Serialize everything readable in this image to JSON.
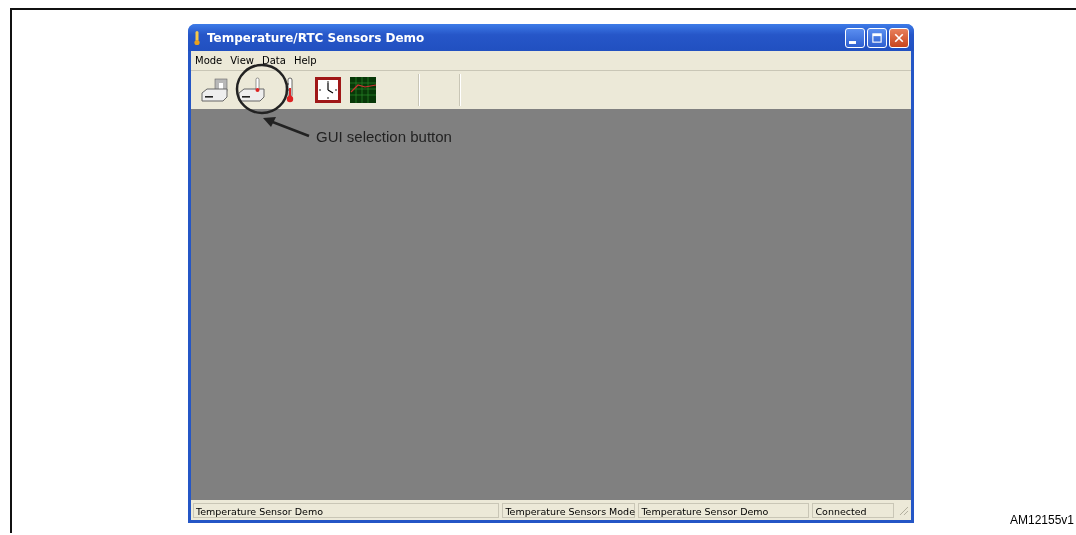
{
  "window": {
    "title": "Temperature/RTC Sensors Demo"
  },
  "menu": [
    "Mode",
    "View",
    "Data",
    "Help"
  ],
  "toolbar": [
    {
      "kind": "board"
    },
    {
      "kind": "board-thermo"
    },
    {
      "kind": "thermometer"
    },
    {
      "kind": "clock"
    },
    {
      "kind": "chart"
    }
  ],
  "annotation": {
    "text": "GUI selection button"
  },
  "status_bar": [
    "Temperature Sensor Demo",
    "Temperature Sensors Mode",
    "Temperature Sensor Demo",
    "Connected"
  ],
  "figure": {
    "label": "AM12155v1"
  }
}
